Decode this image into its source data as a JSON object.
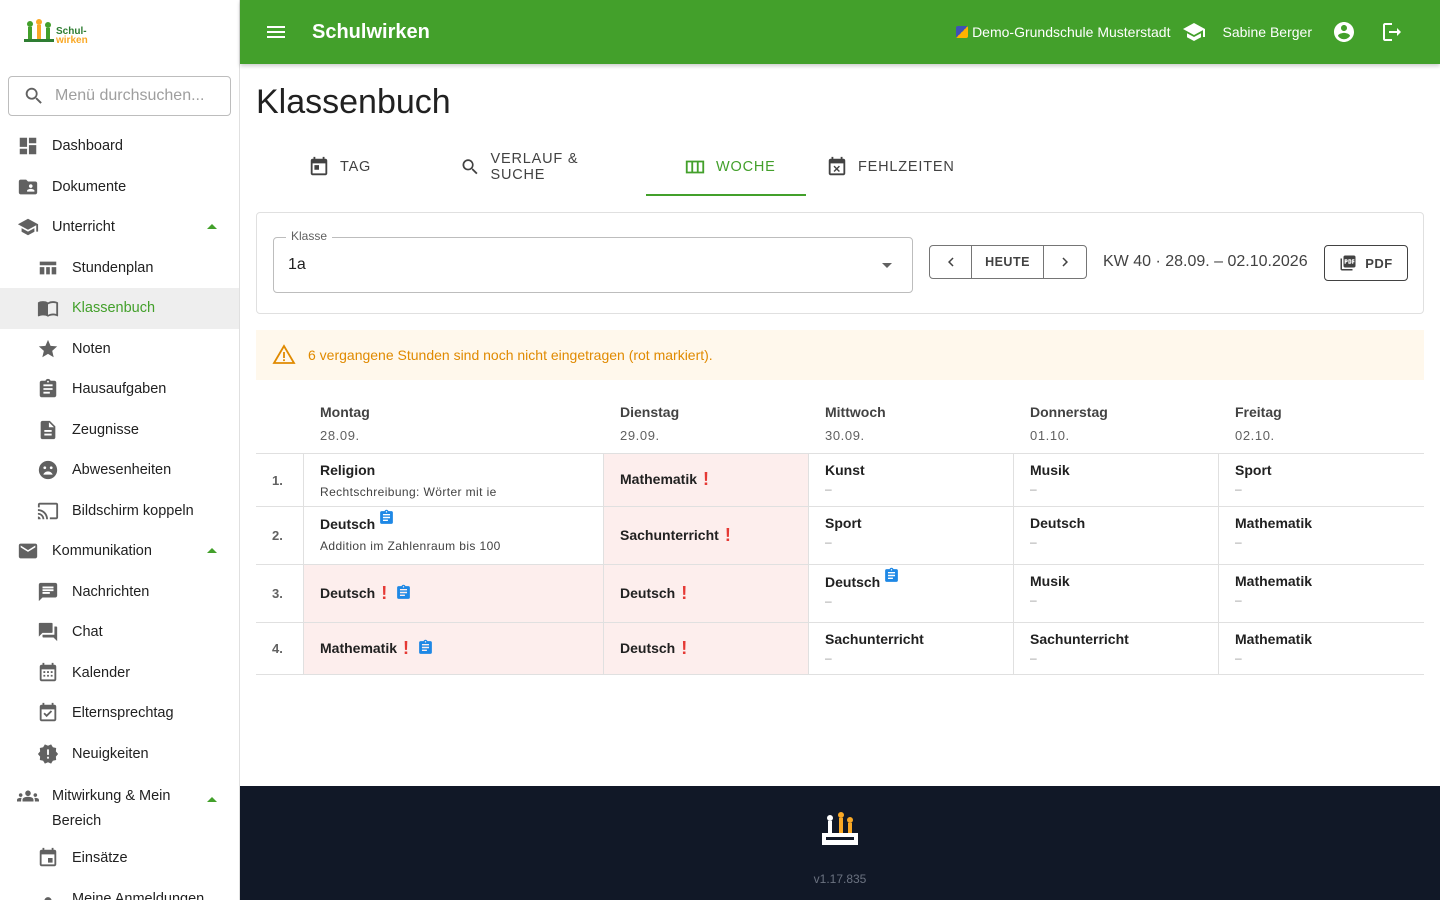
{
  "app": {
    "title": "Schulwirken",
    "logo_text": [
      "Schul-",
      "wirken"
    ],
    "school": "Demo-Grundschule Musterstadt",
    "user": "Sabine Berger"
  },
  "sidebar": {
    "search_placeholder": "Menü durchsuchen...",
    "items": [
      {
        "label": "Dashboard",
        "icon": "dashboard-icon"
      },
      {
        "label": "Dokumente",
        "icon": "folder-shared-icon"
      },
      {
        "label": "Unterricht",
        "icon": "school-icon",
        "expanded": true
      },
      {
        "label": "Stundenplan",
        "icon": "table-icon"
      },
      {
        "label": "Klassenbuch",
        "icon": "book-icon",
        "active": true
      },
      {
        "label": "Noten",
        "icon": "star-icon"
      },
      {
        "label": "Hausaufgaben",
        "icon": "assignment-icon"
      },
      {
        "label": "Zeugnisse",
        "icon": "document-icon"
      },
      {
        "label": "Abwesenheiten",
        "icon": "sick-face-icon"
      },
      {
        "label": "Bildschirm koppeln",
        "icon": "cast-icon"
      },
      {
        "label": "Kommunikation",
        "icon": "mail-icon",
        "expanded": true
      },
      {
        "label": "Nachrichten",
        "icon": "message-icon"
      },
      {
        "label": "Chat",
        "icon": "chat-icon"
      },
      {
        "label": "Kalender",
        "icon": "calendar-icon"
      },
      {
        "label": "Elternsprechtag",
        "icon": "event-check-icon"
      },
      {
        "label": "Neuigkeiten",
        "icon": "news-badge-icon"
      },
      {
        "label": "Mitwirkung & Mein Bereich",
        "icon": "people-icon",
        "expanded": true
      },
      {
        "label": "Einsätze",
        "icon": "event-icon"
      },
      {
        "label": "Meine Anmeldungen",
        "icon": "dot-icon"
      }
    ]
  },
  "page": {
    "title": "Klassenbuch",
    "tabs": [
      {
        "label": "TAG",
        "icon": "calendar-today-icon"
      },
      {
        "label": "VERLAUF & SUCHE",
        "icon": "search-icon"
      },
      {
        "label": "WOCHE",
        "icon": "view-week-icon",
        "active": true
      },
      {
        "label": "FEHLZEITEN",
        "icon": "event-busy-icon"
      }
    ],
    "klasse_label": "Klasse",
    "klasse_value": "1a",
    "today_label": "HEUTE",
    "week_range": "KW 40 · 28.09. – 02.10.2026",
    "pdf_label": "PDF",
    "alert_text": "6 vergangene Stunden sind noch nicht eingetragen (rot markiert).",
    "accent_color": "#43a02b",
    "missing_color": "#fdeeed"
  },
  "week": {
    "days": [
      {
        "name": "Montag",
        "date": "28.09."
      },
      {
        "name": "Dienstag",
        "date": "29.09."
      },
      {
        "name": "Mittwoch",
        "date": "30.09."
      },
      {
        "name": "Donnerstag",
        "date": "01.10."
      },
      {
        "name": "Freitag",
        "date": "02.10."
      }
    ],
    "rows": [
      {
        "num": "1.",
        "slots": [
          {
            "subject": "Religion",
            "topic": "Rechtschreibung: Wörter mit ie",
            "missing": false,
            "homework": false
          },
          {
            "subject": "Mathematik",
            "topic": "",
            "missing": true,
            "homework": false
          },
          {
            "subject": "Kunst",
            "topic": "–",
            "missing": false,
            "homework": false
          },
          {
            "subject": "Musik",
            "topic": "–",
            "missing": false,
            "homework": false
          },
          {
            "subject": "Sport",
            "topic": "–",
            "missing": false,
            "homework": false
          }
        ]
      },
      {
        "num": "2.",
        "slots": [
          {
            "subject": "Deutsch",
            "topic": "Addition im Zahlenraum bis 100",
            "missing": false,
            "homework": true
          },
          {
            "subject": "Sachunterricht",
            "topic": "",
            "missing": true,
            "homework": false
          },
          {
            "subject": "Sport",
            "topic": "–",
            "missing": false,
            "homework": false
          },
          {
            "subject": "Deutsch",
            "topic": "–",
            "missing": false,
            "homework": false
          },
          {
            "subject": "Mathematik",
            "topic": "–",
            "missing": false,
            "homework": false
          }
        ]
      },
      {
        "num": "3.",
        "slots": [
          {
            "subject": "Deutsch",
            "topic": "",
            "missing": true,
            "homework": true
          },
          {
            "subject": "Deutsch",
            "topic": "",
            "missing": true,
            "homework": false
          },
          {
            "subject": "Deutsch",
            "topic": "–",
            "missing": false,
            "homework": true
          },
          {
            "subject": "Musik",
            "topic": "–",
            "missing": false,
            "homework": false
          },
          {
            "subject": "Mathematik",
            "topic": "–",
            "missing": false,
            "homework": false
          }
        ]
      },
      {
        "num": "4.",
        "slots": [
          {
            "subject": "Mathematik",
            "topic": "",
            "missing": true,
            "homework": true
          },
          {
            "subject": "Deutsch",
            "topic": "",
            "missing": true,
            "homework": false
          },
          {
            "subject": "Sachunterricht",
            "topic": "–",
            "missing": false,
            "homework": false
          },
          {
            "subject": "Sachunterricht",
            "topic": "–",
            "missing": false,
            "homework": false
          },
          {
            "subject": "Mathematik",
            "topic": "–",
            "missing": false,
            "homework": false
          }
        ]
      }
    ]
  },
  "footer": {
    "version": "v1.17.835"
  }
}
